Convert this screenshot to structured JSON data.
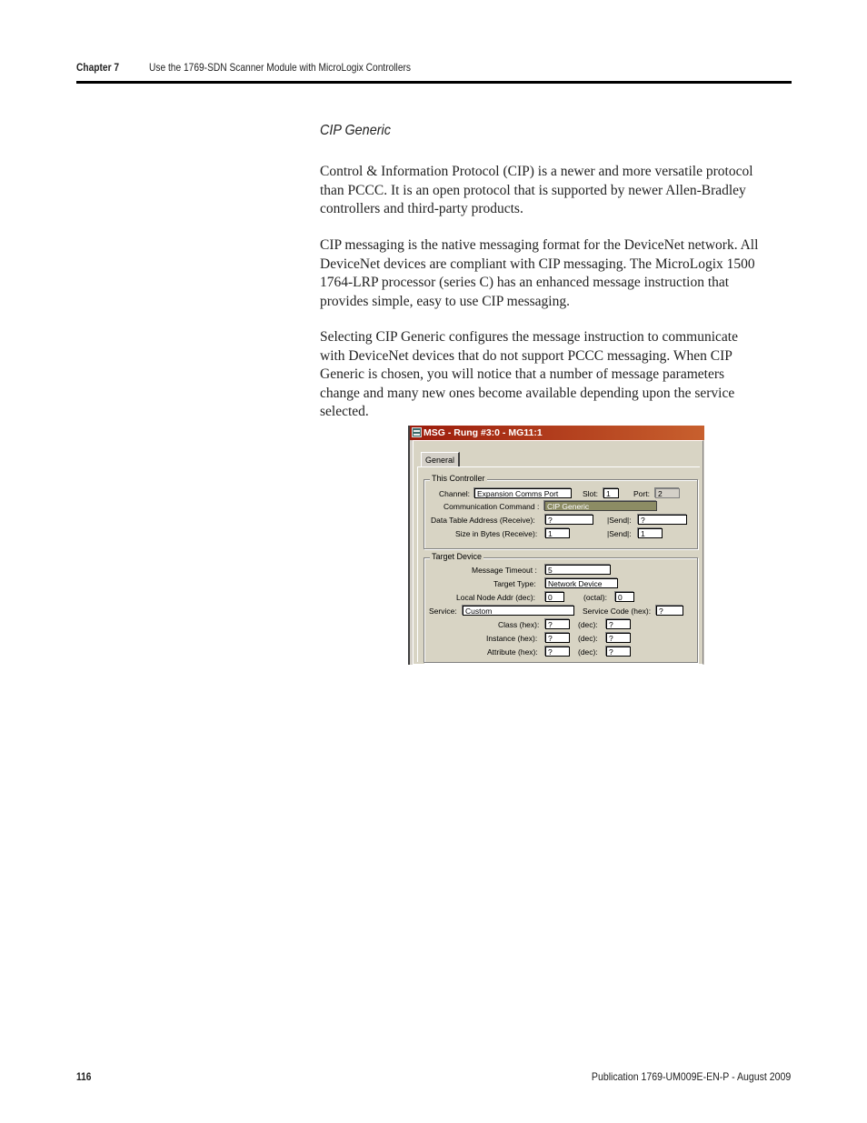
{
  "header": {
    "chapter": "Chapter 7",
    "title": "Use the 1769-SDN Scanner Module with MicroLogix Controllers"
  },
  "section": {
    "title": "CIP Generic",
    "paragraphs": [
      [
        "Control & Information Protocol (CIP) is a newer and more versatile protocol",
        "than PCCC. It is an open protocol that is supported by newer Allen-Bradley",
        "controllers and third-party products."
      ],
      [
        "CIP messaging is the native messaging format for the DeviceNet network. All",
        "DeviceNet devices are compliant with CIP messaging. The MicroLogix 1500",
        "1764-LRP processor (series C) has an enhanced message instruction that",
        "provides simple, easy to use CIP messaging."
      ],
      [
        "Selecting CIP Generic configures the message instruction to communicate",
        "with DeviceNet devices that do not support PCCC messaging. When CIP",
        "Generic is chosen, you will notice that a number of message parameters",
        "change and many new ones become available depending upon the service",
        "selected."
      ]
    ]
  },
  "dialog": {
    "title": "MSG - Rung #3:0 - MG11:1",
    "tab": "General",
    "this_controller": {
      "group_label": "This Controller",
      "channel_label": "Channel:",
      "channel_value": "Expansion Comms Port",
      "slot_label": "Slot:",
      "slot_value": "1",
      "port_label": "Port:",
      "port_value": "2",
      "command_label": "Communication Command :",
      "command_value": "CIP Generic",
      "dta_receive_label": "Data Table Address (Receive):",
      "dta_receive_value": "?",
      "dta_send_label": "|Send|:",
      "dta_send_value": "?",
      "size_receive_label": "Size in Bytes (Receive):",
      "size_receive_value": "1",
      "size_send_label": "|Send|:",
      "size_send_value": "1"
    },
    "target_device": {
      "group_label": "Target Device",
      "timeout_label": "Message Timeout :",
      "timeout_value": "5",
      "target_type_label": "Target Type:",
      "target_type_value": "Network Device",
      "node_addr_label": "Local Node Addr (dec):",
      "node_addr_value": "0",
      "octal_label": "(octal):",
      "octal_value": "0",
      "service_label": "Service:",
      "service_value": "Custom",
      "service_code_label": "Service Code (hex):",
      "service_code_value": "?",
      "class_label": "Class (hex):",
      "class_hex": "?",
      "class_dec_label": "(dec):",
      "class_dec": "?",
      "instance_label": "Instance (hex):",
      "instance_hex": "?",
      "instance_dec_label": "(dec):",
      "instance_dec": "?",
      "attribute_label": "Attribute (hex):",
      "attribute_hex": "?",
      "attribute_dec_label": "(dec):",
      "attribute_dec": "?"
    }
  },
  "footer": {
    "page_number": "116",
    "publication": "Publication 1769-UM009E-EN-P - August 2009"
  }
}
